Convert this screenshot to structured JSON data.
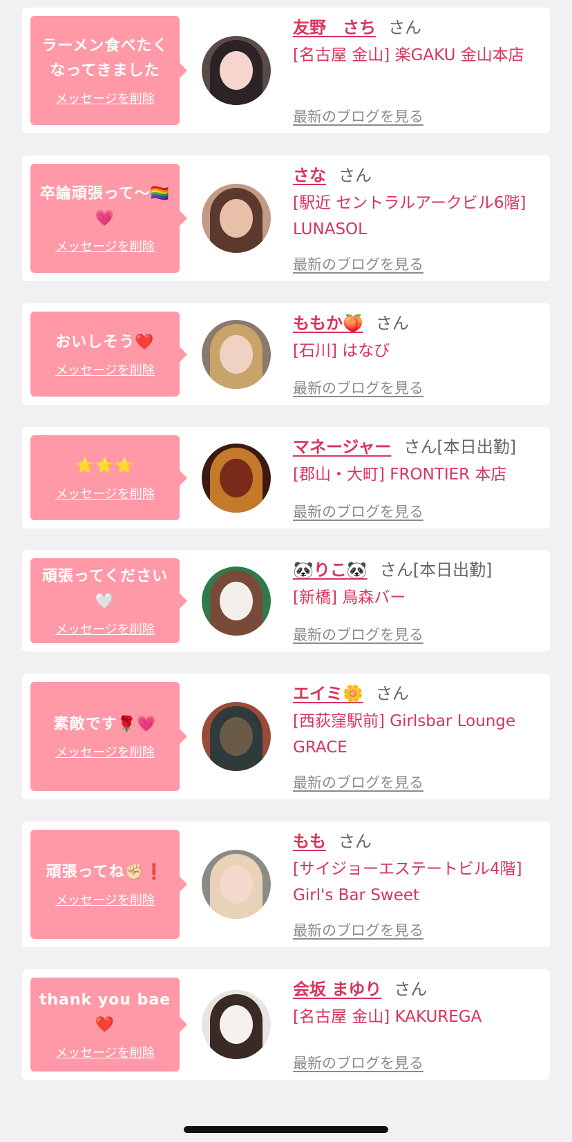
{
  "delete_label": "メッセージを削除",
  "blog_label": "最新のブログを見る",
  "colors": {
    "accent": "#d9345b",
    "bubble": "#ff99a7",
    "background": "#f1f1f3"
  },
  "entries": [
    {
      "message": "ラーメン食べたくなってきました",
      "name": "友野　さち",
      "suffix": "さん",
      "shop": "[名古屋 金山] 楽GAKU 金山本店",
      "avatar": "avatar-portrait"
    },
    {
      "message": "卒論頑張って〜🏳️‍🌈💗",
      "name": "さな",
      "suffix": "さん",
      "shop": "[駅近 セントラルアークビル6階] LUNASOL",
      "avatar": "avatar-portrait"
    },
    {
      "message": "おいしそう❤️",
      "name": "ももか🍑",
      "suffix": "さん",
      "shop": "[石川] はなび",
      "avatar": "avatar-portrait"
    },
    {
      "message": "⭐️⭐️⭐️",
      "name": "マネージャー",
      "suffix": "さん[本日出勤]",
      "shop": "[郡山・大町] FRONTIER 本店",
      "avatar": "avatar-bar-interior"
    },
    {
      "message": "頑張ってください🤍",
      "name": "🐼りこ🐼",
      "suffix": "さん[本日出勤]",
      "shop": "[新橋] 鳥森バー",
      "avatar": "avatar-portrait"
    },
    {
      "message": "素敵です🌹💗",
      "name": "エイミ🌼",
      "suffix": "さん",
      "shop": "[西荻窪駅前] Girlsbar Lounge GRACE",
      "avatar": "avatar-street"
    },
    {
      "message": "頑張ってね✊🏻❗️",
      "name": "もも",
      "suffix": "さん",
      "shop": "[サイジョーエステートビル4階] Girl's Bar Sweet",
      "avatar": "avatar-portrait"
    },
    {
      "message": "thank you bae❤️",
      "name": "会坂 まゆり",
      "suffix": "さん",
      "shop": "[名古屋 金山] KAKUREGA",
      "avatar": "avatar-portrait"
    }
  ]
}
